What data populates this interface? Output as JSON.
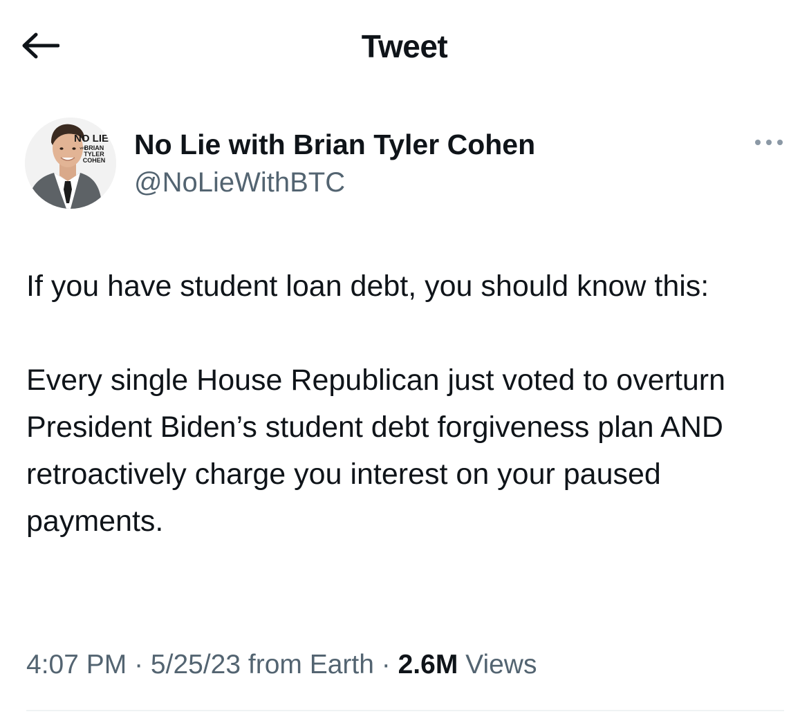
{
  "header": {
    "title": "Tweet",
    "back_icon": "arrow-left-icon"
  },
  "author": {
    "display_name": "No Lie with Brian Tyler Cohen",
    "handle": "@NoLieWithBTC",
    "avatar": {
      "logo_line1": "NO LIE",
      "logo_with": "with",
      "logo_line2": "BRIAN",
      "logo_line3": "TYLER",
      "logo_line4": "COHEN"
    },
    "more_icon": "more-horizontal-icon"
  },
  "tweet": {
    "paragraph_1": "If you have student loan debt, you should know this:",
    "paragraph_2": "Every single House Republican just voted to overturn President Biden’s student debt forgiveness plan AND retroactively charge you interest on your paused payments."
  },
  "meta": {
    "time": "4:07 PM",
    "separator_1": " · ",
    "date": "5/25/23",
    "source": " from Earth",
    "separator_2": " · ",
    "views_count": "2.6M",
    "views_label": " Views"
  },
  "colors": {
    "primary_text": "#0f1419",
    "secondary_text": "#536471",
    "divider": "#eff3f4",
    "background": "#ffffff"
  }
}
